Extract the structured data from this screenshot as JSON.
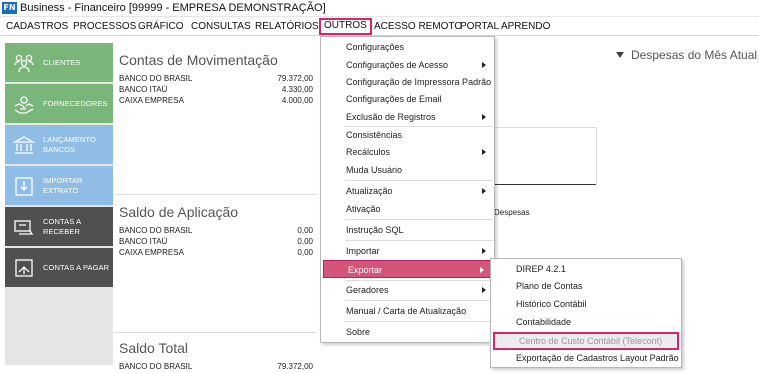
{
  "window": {
    "logo_text": "FN",
    "title": "Business - Financeiro  [99999 - EMPRESA DEMONSTRAÇÃO]"
  },
  "menubar": [
    {
      "label": "CADASTROS"
    },
    {
      "label": "PROCESSOS"
    },
    {
      "label": "GRÁFICO"
    },
    {
      "label": "CONSULTAS"
    },
    {
      "label": "RELATÓRIOS"
    },
    {
      "label": "OUTROS"
    },
    {
      "label": "ACESSO REMOTO"
    },
    {
      "label": "PORTAL APRENDO"
    }
  ],
  "sidebar": [
    {
      "label": "CLIENTES",
      "icon": "clients-icon"
    },
    {
      "label": "FORNECEDORES",
      "icon": "suppliers-icon"
    },
    {
      "label": "LANÇAMENTO BANCOS",
      "icon": "bank-icon"
    },
    {
      "label": "IMPORTAR EXTRATO",
      "icon": "import-statement-icon"
    },
    {
      "label": "CONTAS A RECEBER",
      "icon": "receivables-icon"
    },
    {
      "label": "CONTAS A PAGAR",
      "icon": "payables-icon"
    }
  ],
  "panels": {
    "movimentacao": {
      "title": "Contas de Movimentação",
      "rows": [
        {
          "name": "BANCO DO BRASIL",
          "value": "79.372,00"
        },
        {
          "name": "BANCO ITAÚ",
          "value": "4.330,00"
        },
        {
          "name": "CAIXA EMPRESA",
          "value": "4.000,00"
        }
      ]
    },
    "aplicacao": {
      "title": "Saldo de Aplicação",
      "rows": [
        {
          "name": "BANCO DO BRASIL",
          "value": "0,00"
        },
        {
          "name": "BANCO ITAÚ",
          "value": "0,00"
        },
        {
          "name": "CAIXA EMPRESA",
          "value": "0,00"
        }
      ]
    },
    "total": {
      "title": "Saldo Total",
      "rows": [
        {
          "name": "BANCO DO BRASIL",
          "value": "79.372,00"
        }
      ]
    }
  },
  "right": {
    "title": "Despesas do Mês Atual",
    "partial_label": "Despesas"
  },
  "outros_menu": [
    {
      "label": "Configurações",
      "submenu": false
    },
    {
      "label": "Configurações de Acesso",
      "submenu": true
    },
    {
      "label": "Configuração de Impressora Padrão",
      "submenu": false
    },
    {
      "label": "Configurações de Email",
      "submenu": false
    },
    {
      "label": "Exclusão de Registros",
      "submenu": true
    },
    {
      "label": "Consistências",
      "submenu": false
    },
    {
      "label": "Recálculos",
      "submenu": true
    },
    {
      "label": "Muda Usuário",
      "submenu": false
    },
    {
      "label": "Atualização",
      "submenu": true
    },
    {
      "label": "Ativação",
      "submenu": false
    },
    {
      "label": "Instrução SQL",
      "submenu": false
    },
    {
      "label": "Importar",
      "submenu": true
    },
    {
      "label": "Exportar",
      "submenu": true,
      "highlighted": true
    },
    {
      "label": "Geradores",
      "submenu": true
    },
    {
      "label": "Manual / Carta de Atualização",
      "submenu": false
    },
    {
      "label": "Sobre",
      "submenu": false
    }
  ],
  "exportar_menu": [
    {
      "label": "DIREP 4.2.1"
    },
    {
      "label": "Plano de Contas"
    },
    {
      "label": "Histórico Contábil"
    },
    {
      "label": "Contabilidade"
    },
    {
      "label": "Centro de Custo Contábil (Telecont)",
      "highlighted": true
    },
    {
      "label": "Exportação de Cadastros Layout Padrão"
    }
  ],
  "colors": {
    "accent": "#d6246e",
    "sidebar_green": "#7ab57a",
    "sidebar_blue": "#8fbde6",
    "sidebar_dark": "#505050",
    "logo_blue": "#1c6fbe"
  }
}
